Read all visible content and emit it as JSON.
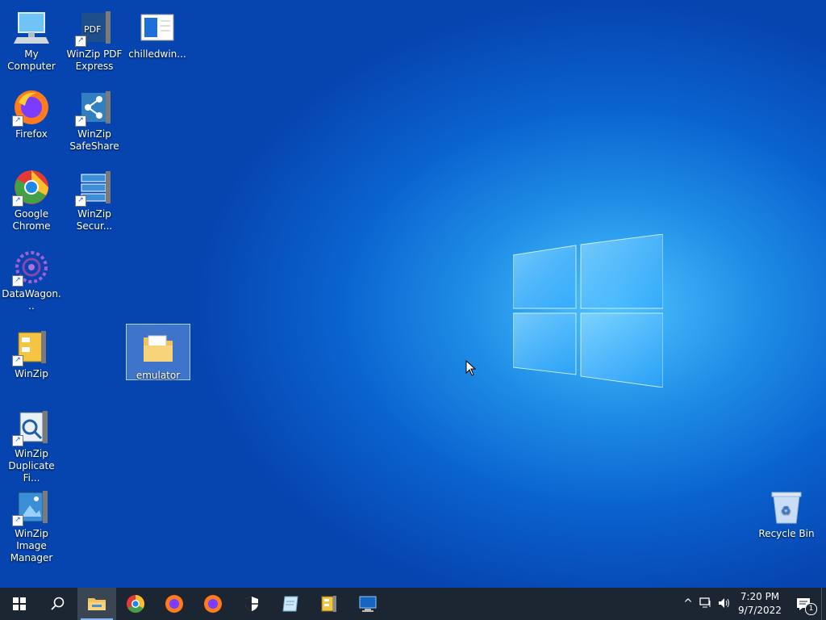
{
  "desktop": {
    "icons": [
      {
        "label": "My Computer"
      },
      {
        "label": "WinZip PDF Express"
      },
      {
        "label": "chilledwin..."
      },
      {
        "label": "Firefox"
      },
      {
        "label": "WinZip SafeShare"
      },
      {
        "label": "Google Chrome"
      },
      {
        "label": "WinZip Secur..."
      },
      {
        "label": "DataWagon..."
      },
      {
        "label": "WinZip"
      },
      {
        "label": "emulator"
      },
      {
        "label": "WinZip Duplicate Fi..."
      },
      {
        "label": "WinZip Image Manager"
      },
      {
        "label": "Recycle Bin"
      }
    ]
  },
  "taskbar": {
    "clock_time": "7:20 PM",
    "clock_date": "9/7/2022",
    "notification_count": "1",
    "pinned": [
      "start-icon",
      "search-icon",
      "file-explorer-icon",
      "chrome-icon",
      "firefox-icon",
      "firefox-icon",
      "security-shield-icon",
      "notepad-icon",
      "winzip-icon",
      "remote-desktop-icon"
    ]
  },
  "colors": {
    "accent": "#0a63cf",
    "taskbar": "#1c2532"
  }
}
